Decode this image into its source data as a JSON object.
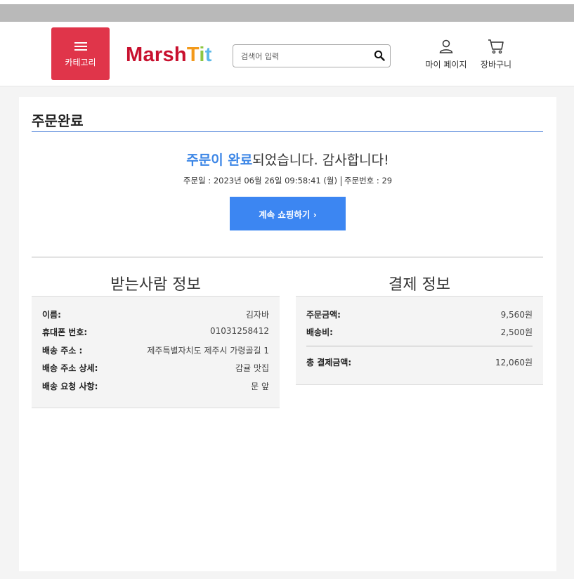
{
  "header": {
    "category_label": "카테고리",
    "logo_parts": [
      "Marsh",
      "T",
      "i",
      "t"
    ],
    "search_placeholder": "검색어 입력",
    "mypage_label": "마이 페이지",
    "cart_label": "장바구니"
  },
  "icons": {
    "menu": "menu-icon",
    "search": "search-icon",
    "user": "user-icon",
    "cart": "cart-icon"
  },
  "colors": {
    "category_button": "#e0354a",
    "accent_blue": "#3c86f2",
    "title_underline": "#4a7fd8",
    "logo": [
      "#c8102e",
      "#f39a1b",
      "#8cc63f",
      "#5bb8e8"
    ]
  },
  "main": {
    "page_title": "주문완료",
    "message_highlight": "주문이 완료",
    "message_rest": "되었습니다. 감사합니다!",
    "order_date": "주문일 : 2023년 06월 26일 09:58:41 (월)",
    "order_number": "주문번호 : 29",
    "continue_button": "계속 쇼핑하기 ›"
  },
  "recipient": {
    "title": "받는사람 정보",
    "rows": [
      {
        "label": "이름:",
        "value": "김자바"
      },
      {
        "label": "휴대폰 번호:",
        "value": "01031258412"
      },
      {
        "label": "배송 주소 :",
        "value": "제주특별자치도 제주시 가령골길 1"
      },
      {
        "label": "배송 주소 상세:",
        "value": "감귤 맛집"
      },
      {
        "label": "배송 요청 사항:",
        "value": "문 앞"
      }
    ]
  },
  "payment": {
    "title": "결제 정보",
    "rows": [
      {
        "label": "주문금액:",
        "value": "9,560원"
      },
      {
        "label": "배송비:",
        "value": "2,500원"
      }
    ],
    "total": {
      "label": "총 결제금액:",
      "value": "12,060원"
    }
  }
}
